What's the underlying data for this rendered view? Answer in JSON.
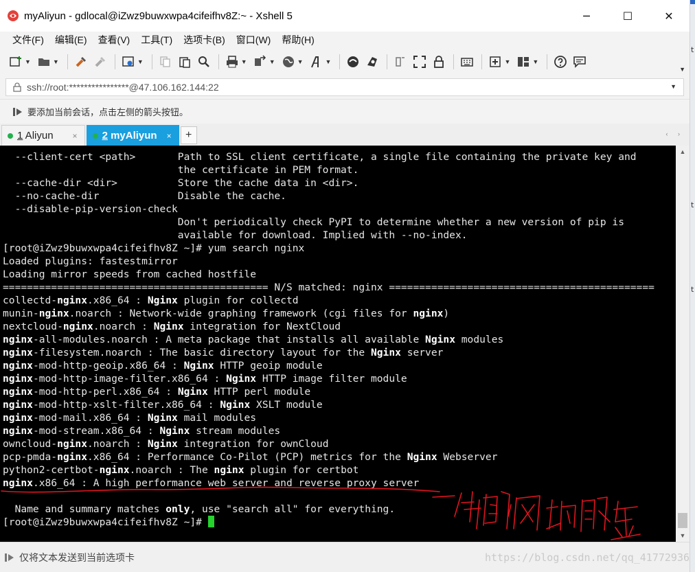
{
  "window": {
    "title": "myAliyun - gdlocal@iZwz9buwxwpa4cifeifhv8Z:~ - Xshell 5",
    "controls": {
      "minimize": "─",
      "maximize": "☐",
      "close": "✕"
    }
  },
  "menu": [
    "文件(F)",
    "编辑(E)",
    "查看(V)",
    "工具(T)",
    "选项卡(B)",
    "窗口(W)",
    "帮助(H)"
  ],
  "address": {
    "value": "ssh://root:****************@47.106.162.144:22"
  },
  "hint": {
    "text": "要添加当前会话，点击左侧的箭头按钮。"
  },
  "tabs": [
    {
      "num": "1",
      "name": " Aliyun",
      "close": "×",
      "active": false
    },
    {
      "num": "2",
      "name": " myAliyun",
      "close": "×",
      "active": true
    }
  ],
  "tab_add": "+",
  "tab_nav": "‹ ›",
  "terminal": {
    "lines": [
      [
        {
          "t": "  --client-cert <path>       Path to SSL client certificate, a single file containing the private key and"
        }
      ],
      [
        {
          "t": "                             the certificate in PEM format."
        }
      ],
      [
        {
          "t": "  --cache-dir <dir>          Store the cache data in <dir>."
        }
      ],
      [
        {
          "t": "  --no-cache-dir             Disable the cache."
        }
      ],
      [
        {
          "t": "  --disable-pip-version-check"
        }
      ],
      [
        {
          "t": "                             Don't periodically check PyPI to determine whether a new version of pip is"
        }
      ],
      [
        {
          "t": "                             available for download. Implied with --no-index."
        }
      ],
      [
        {
          "t": "[root@iZwz9buwxwpa4cifeifhv8Z ~]# yum search nginx"
        }
      ],
      [
        {
          "t": "Loaded plugins: fastestmirror"
        }
      ],
      [
        {
          "t": "Loading mirror speeds from cached hostfile"
        }
      ],
      [
        {
          "t": "============================================ N/S matched: nginx ============================================"
        }
      ],
      [
        {
          "t": "collectd-"
        },
        {
          "t": "nginx",
          "b": true
        },
        {
          "t": ".x86_64 : "
        },
        {
          "t": "Nginx",
          "b": true
        },
        {
          "t": " plugin for collectd"
        }
      ],
      [
        {
          "t": "munin-"
        },
        {
          "t": "nginx",
          "b": true
        },
        {
          "t": ".noarch : Network-wide graphing framework (cgi files for "
        },
        {
          "t": "nginx",
          "b": true
        },
        {
          "t": ")"
        }
      ],
      [
        {
          "t": "nextcloud-"
        },
        {
          "t": "nginx",
          "b": true
        },
        {
          "t": ".noarch : "
        },
        {
          "t": "Nginx",
          "b": true
        },
        {
          "t": " integration for NextCloud"
        }
      ],
      [
        {
          "t": "nginx",
          "b": true
        },
        {
          "t": "-all-modules.noarch : A meta package that installs all available "
        },
        {
          "t": "Nginx",
          "b": true
        },
        {
          "t": " modules"
        }
      ],
      [
        {
          "t": "nginx",
          "b": true
        },
        {
          "t": "-filesystem.noarch : The basic directory layout for the "
        },
        {
          "t": "Nginx",
          "b": true
        },
        {
          "t": " server"
        }
      ],
      [
        {
          "t": "nginx",
          "b": true
        },
        {
          "t": "-mod-http-geoip.x86_64 : "
        },
        {
          "t": "Nginx",
          "b": true
        },
        {
          "t": " HTTP geoip module"
        }
      ],
      [
        {
          "t": "nginx",
          "b": true
        },
        {
          "t": "-mod-http-image-filter.x86_64 : "
        },
        {
          "t": "Nginx",
          "b": true
        },
        {
          "t": " HTTP image filter module"
        }
      ],
      [
        {
          "t": "nginx",
          "b": true
        },
        {
          "t": "-mod-http-perl.x86_64 : "
        },
        {
          "t": "Nginx",
          "b": true
        },
        {
          "t": " HTTP perl module"
        }
      ],
      [
        {
          "t": "nginx",
          "b": true
        },
        {
          "t": "-mod-http-xslt-filter.x86_64 : "
        },
        {
          "t": "Nginx",
          "b": true
        },
        {
          "t": " XSLT module"
        }
      ],
      [
        {
          "t": "nginx",
          "b": true
        },
        {
          "t": "-mod-mail.x86_64 : "
        },
        {
          "t": "Nginx",
          "b": true
        },
        {
          "t": " mail modules"
        }
      ],
      [
        {
          "t": "nginx",
          "b": true
        },
        {
          "t": "-mod-stream.x86_64 : "
        },
        {
          "t": "Nginx",
          "b": true
        },
        {
          "t": " stream modules"
        }
      ],
      [
        {
          "t": "owncloud-"
        },
        {
          "t": "nginx",
          "b": true
        },
        {
          "t": ".noarch : "
        },
        {
          "t": "Nginx",
          "b": true
        },
        {
          "t": " integration for ownCloud"
        }
      ],
      [
        {
          "t": "pcp-pmda-"
        },
        {
          "t": "nginx",
          "b": true
        },
        {
          "t": ".x86_64 : Performance Co-Pilot (PCP) metrics for the "
        },
        {
          "t": "Nginx",
          "b": true
        },
        {
          "t": " Webserver"
        }
      ],
      [
        {
          "t": "python2-certbot-"
        },
        {
          "t": "nginx",
          "b": true
        },
        {
          "t": ".noarch : The "
        },
        {
          "t": "nginx",
          "b": true
        },
        {
          "t": " plugin for certbot"
        }
      ],
      [
        {
          "t": "nginx",
          "b": true
        },
        {
          "t": ".x86_64 : A high performance web server and reverse proxy server"
        }
      ],
      [
        {
          "t": ""
        }
      ],
      [
        {
          "t": "  Name and summary matches "
        },
        {
          "t": "only",
          "b": true
        },
        {
          "t": ", use \"search all\" for everything."
        }
      ],
      [
        {
          "t": "[root@iZwz9buwxwpa4cifeifhv8Z ~]# "
        },
        {
          "cursor": true
        }
      ]
    ]
  },
  "annotation": {
    "text": "代理的网站服务器",
    "color": "#e0141e"
  },
  "status": {
    "text": "仅将文本发送到当前选项卡"
  },
  "watermark": "https://blog.csdn.net/qq_41772936",
  "colors": {
    "tab_active": "#1a9fdf",
    "cursor": "#25d22e",
    "connected_dot": "#22b14c"
  }
}
